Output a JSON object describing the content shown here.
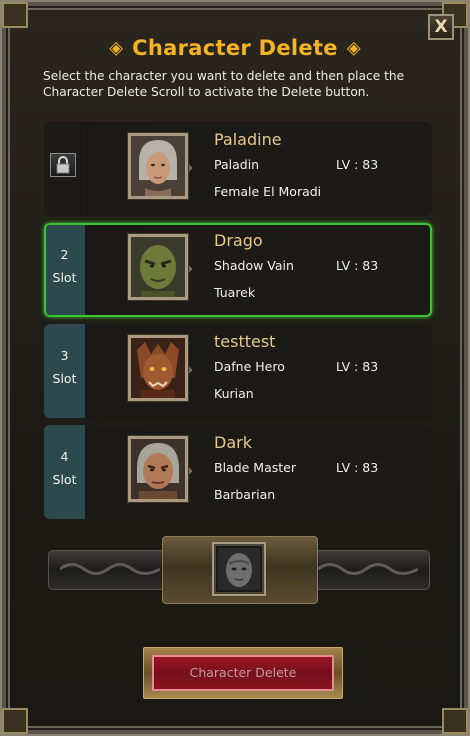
{
  "window": {
    "title": "Character Delete",
    "close_label": "X",
    "description": "Select the character you want to delete and then place the Character Delete Scroll to activate the Delete button."
  },
  "slots": [
    {
      "number": "",
      "slot_label": "",
      "locked": true,
      "selected": false,
      "name": "Paladine",
      "class": "Paladin",
      "level": "LV : 83",
      "race": "Female El Moradi",
      "portrait": "female-human-portrait"
    },
    {
      "number": "2",
      "slot_label": "Slot",
      "locked": false,
      "selected": true,
      "name": "Drago",
      "class": "Shadow Vain",
      "level": "LV : 83",
      "race": "Tuarek",
      "portrait": "orc-portrait"
    },
    {
      "number": "3",
      "slot_label": "Slot",
      "locked": false,
      "selected": false,
      "name": "testtest",
      "class": "Dafne Hero",
      "level": "LV : 83",
      "race": "Kurian",
      "portrait": "kurian-portrait"
    },
    {
      "number": "4",
      "slot_label": "Slot",
      "locked": false,
      "selected": false,
      "name": "Dark",
      "class": "Blade Master",
      "level": "LV : 83",
      "race": "Barbarian",
      "portrait": "barbarian-portrait"
    }
  ],
  "scroll_slot": {
    "icon": "delete-scroll-item-icon"
  },
  "actions": {
    "delete_label": "Character Delete"
  },
  "colors": {
    "title": "#f6b324",
    "selected_border": "#3cc232",
    "name": "#e6c98c",
    "slot_tab": "#2c4a4e",
    "delete_button": "#8a1422"
  }
}
